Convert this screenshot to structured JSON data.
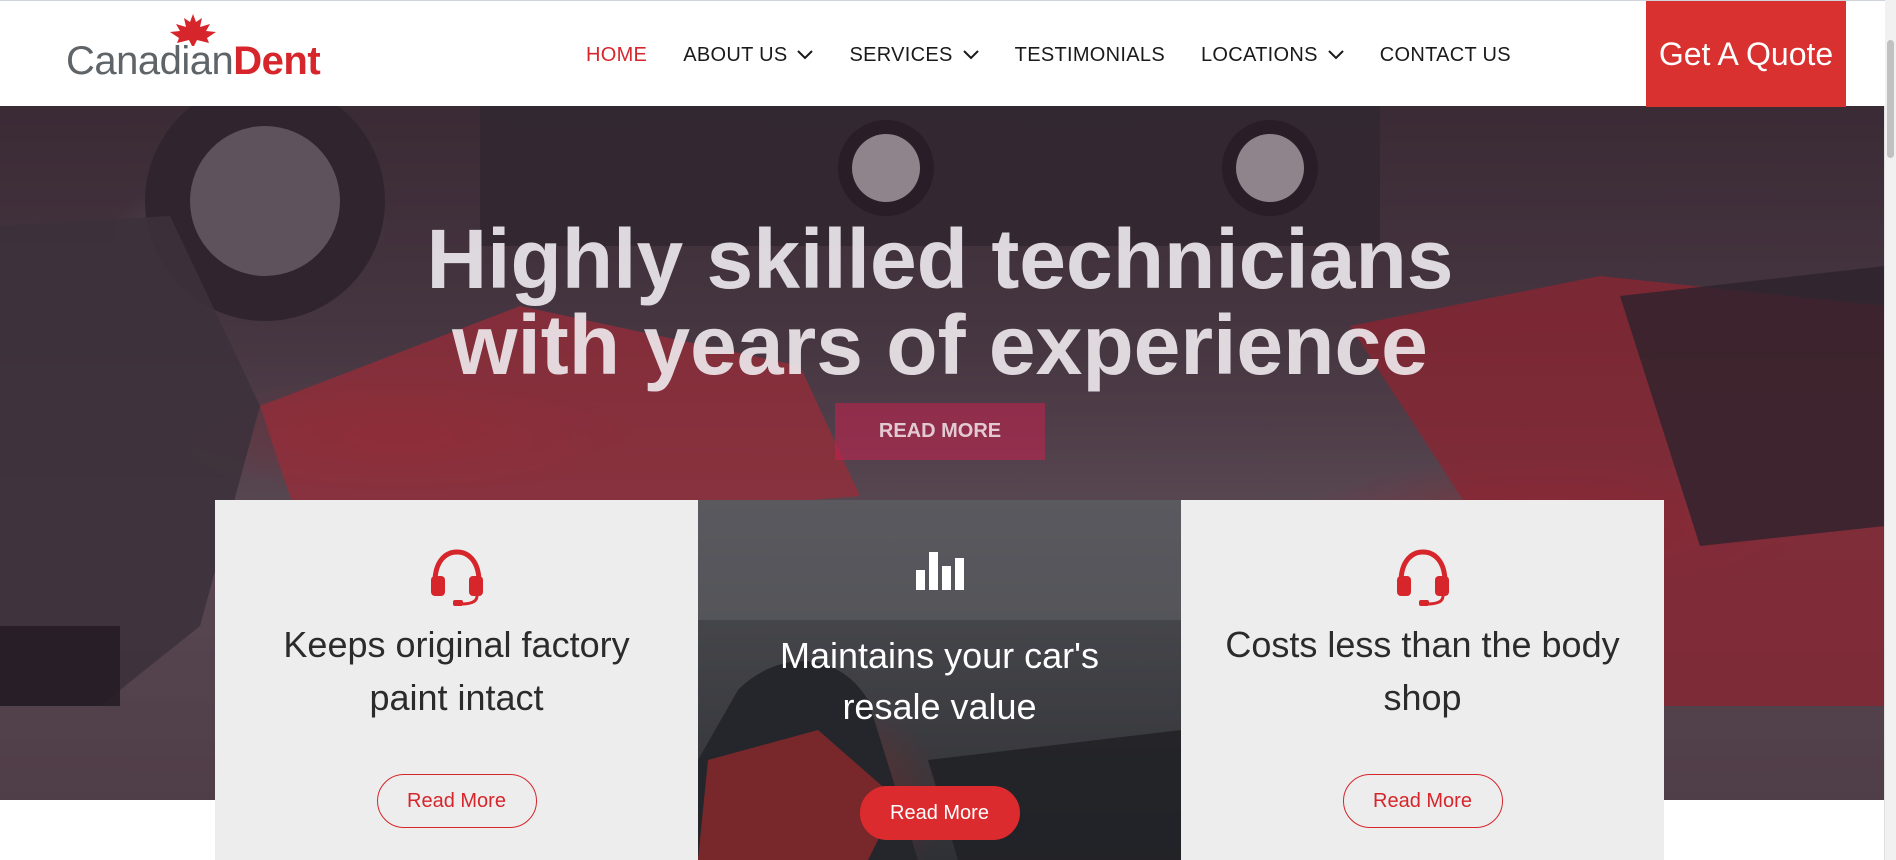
{
  "header": {
    "logo": {
      "part1": "Canadian",
      "part2": "Dent"
    },
    "nav": [
      {
        "label": "HOME",
        "active": true,
        "dropdown": false
      },
      {
        "label": "ABOUT US",
        "active": false,
        "dropdown": true
      },
      {
        "label": "SERVICES",
        "active": false,
        "dropdown": true
      },
      {
        "label": "TESTIMONIALS",
        "active": false,
        "dropdown": false
      },
      {
        "label": "LOCATIONS",
        "active": false,
        "dropdown": true
      },
      {
        "label": "CONTACT US",
        "active": false,
        "dropdown": false
      }
    ],
    "quote_button": "Get A Quote"
  },
  "hero": {
    "title_line1": "Highly skilled technicians",
    "title_line2": "with years of experience",
    "button": "READ MORE"
  },
  "features": [
    {
      "icon": "headset-icon",
      "title": "Keeps original factory paint intact",
      "button": "Read More"
    },
    {
      "icon": "bar-chart-icon",
      "title": "Maintains your car's resale value",
      "button": "Read More"
    },
    {
      "icon": "headset-icon",
      "title": "Costs less than the body shop",
      "button": "Read More"
    }
  ],
  "colors": {
    "brand_red": "#d6262c",
    "quote_bg": "#d83130",
    "card_bg": "#ededed"
  }
}
